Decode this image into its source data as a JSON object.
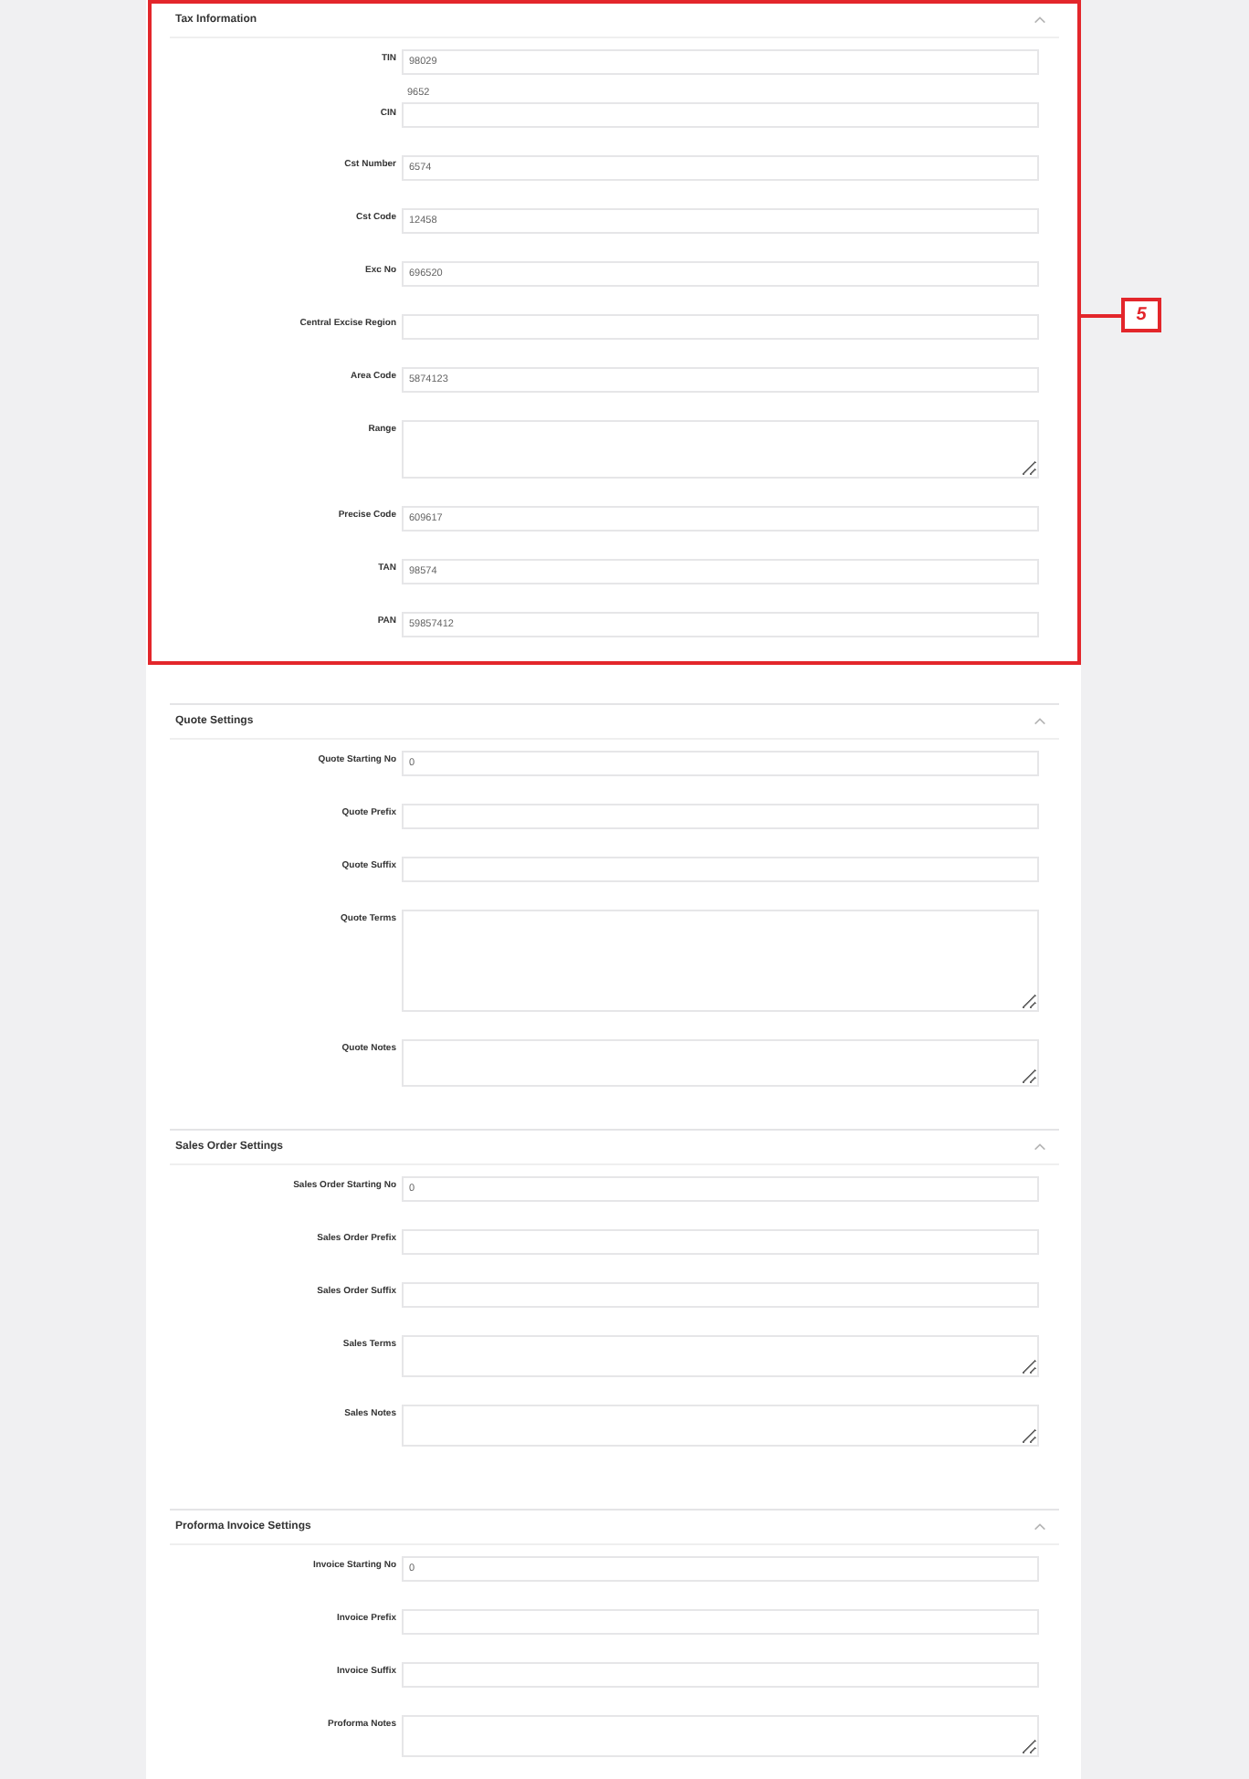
{
  "sections": [
    {
      "title": "Tax Information",
      "expanded": true,
      "callout": "5",
      "fields": [
        {
          "label": "TIN",
          "kind": "input",
          "value": "98029"
        },
        {
          "label": "CIN",
          "kind": "value_above",
          "value": "9652"
        },
        {
          "label": "Cst Number",
          "kind": "input",
          "value": "6574"
        },
        {
          "label": "Cst Code",
          "kind": "input",
          "value": "12458"
        },
        {
          "label": "Exc No",
          "kind": "input",
          "value": "696520"
        },
        {
          "label": "Central Excise Region",
          "kind": "input"
        },
        {
          "label": "Area Code",
          "kind": "input",
          "value": "5874123"
        },
        {
          "label": "Range",
          "kind": "textarea"
        },
        {
          "label": "Precise Code",
          "kind": "input",
          "value": "609617"
        },
        {
          "label": "TAN",
          "kind": "input",
          "value": "98574"
        },
        {
          "label": "PAN",
          "kind": "input",
          "value": "59857412"
        }
      ]
    },
    {
      "title": "Quote Settings",
      "expanded": true,
      "fields": [
        {
          "label": "Quote Starting No",
          "kind": "input",
          "value": "0"
        },
        {
          "label": "Quote Prefix",
          "kind": "input"
        },
        {
          "label": "Quote Suffix",
          "kind": "input"
        },
        {
          "label": "Quote Terms",
          "kind": "textarea"
        },
        {
          "label": "Quote Notes",
          "kind": "textarea"
        }
      ]
    },
    {
      "title": "Sales Order Settings",
      "expanded": true,
      "fields": [
        {
          "label": "Sales Order Starting No",
          "kind": "input",
          "value": "0"
        },
        {
          "label": "Sales Order Prefix",
          "kind": "input"
        },
        {
          "label": "Sales Order Suffix",
          "kind": "input"
        },
        {
          "label": "Sales Terms",
          "kind": "textarea"
        },
        {
          "label": "Sales Notes",
          "kind": "textarea"
        }
      ]
    },
    {
      "title": "Proforma Invoice Settings",
      "expanded": true,
      "fields": [
        {
          "label": "Invoice Starting No",
          "kind": "input",
          "value": "0"
        },
        {
          "label": "Invoice Prefix",
          "kind": "input"
        },
        {
          "label": "Invoice Suffix",
          "kind": "input"
        },
        {
          "label": "Proforma Notes",
          "kind": "textarea"
        }
      ]
    }
  ]
}
